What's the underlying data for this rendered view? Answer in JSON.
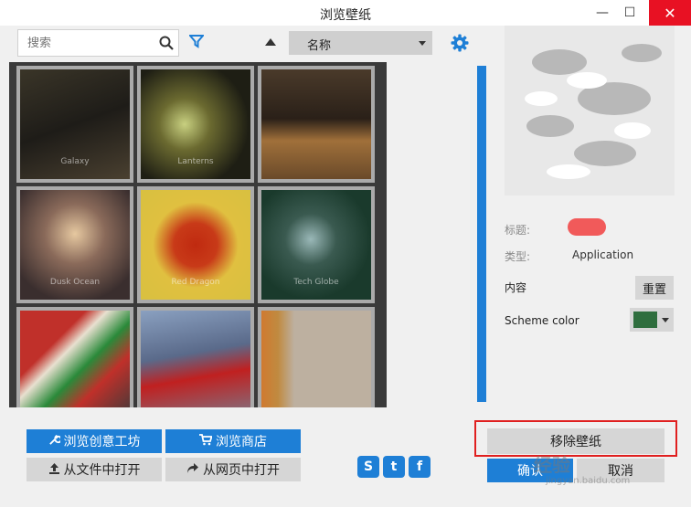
{
  "window": {
    "title": "浏览壁纸",
    "minimize_glyph": "—",
    "maximize_glyph": "☐",
    "close_glyph": "✕"
  },
  "toolbar": {
    "search_placeholder": "搜索",
    "sort_label": "名称",
    "search_icon": "search-icon",
    "filter_icon": "filter-icon",
    "gear_icon": "gear-icon"
  },
  "wallpapers": [
    {
      "caption": "Galaxy"
    },
    {
      "caption": "Lanterns"
    },
    {
      "caption": ""
    },
    {
      "caption": "Dusk Ocean"
    },
    {
      "caption": "Red Dragon"
    },
    {
      "caption": "Tech Globe"
    },
    {
      "caption": ""
    },
    {
      "caption": ""
    },
    {
      "caption": ""
    }
  ],
  "details": {
    "title_label": "标题:",
    "type_label": "类型:",
    "type_value": "Application",
    "content_label": "内容",
    "reset_button": "重置",
    "scheme_label": "Scheme color",
    "scheme_color": "#2f6e3e"
  },
  "buttons": {
    "workshop": "浏览创意工坊",
    "store": "浏览商店",
    "open_file": "从文件中打开",
    "open_web": "从网页中打开",
    "remove": "移除壁纸",
    "ok": "确认",
    "cancel": "取消"
  },
  "social": {
    "steam": "S",
    "twitter": "t",
    "facebook": "f"
  },
  "watermark": {
    "main": "经验",
    "sub": "jingyan.baidu.com"
  },
  "colors": {
    "accent": "#1e7fd6",
    "close": "#e81123",
    "highlight": "#e02020",
    "title_pill": "#f15a5a"
  }
}
